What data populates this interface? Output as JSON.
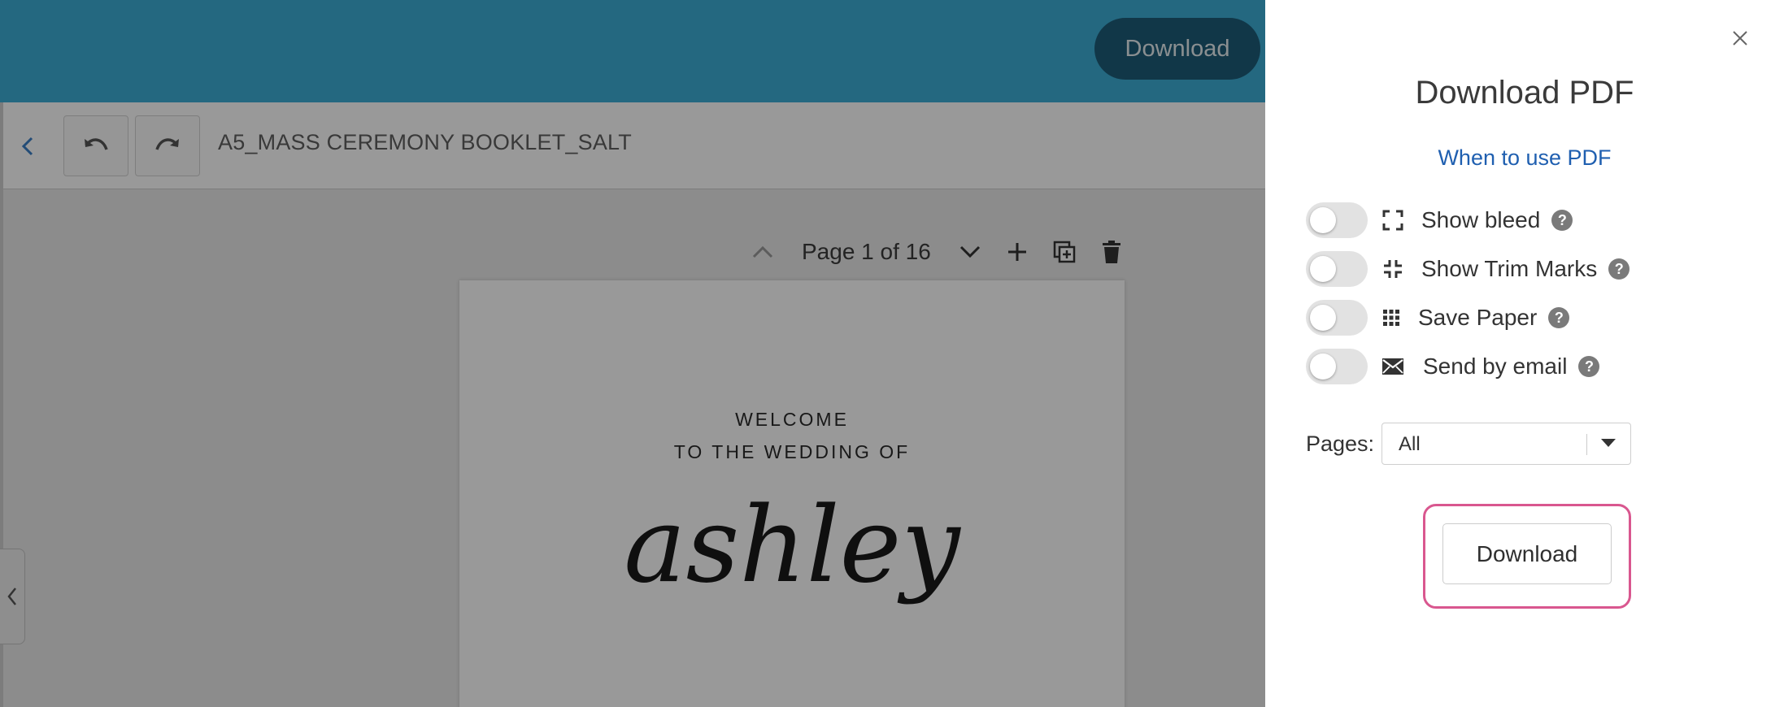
{
  "header": {
    "download_label": "Download"
  },
  "toolbar": {
    "document_title": "A5_MASS CEREMONY BOOKLET_SALT"
  },
  "page_nav": {
    "label": "Page 1 of 16"
  },
  "page_content": {
    "welcome_line1": "WELCOME",
    "welcome_line2": "TO THE WEDDING OF",
    "script_name": "ashley"
  },
  "modal": {
    "title": "Download PDF",
    "help_link": "When to use PDF",
    "options": [
      {
        "label": "Show bleed",
        "icon": "expand-corners-icon",
        "enabled": false
      },
      {
        "label": "Show Trim Marks",
        "icon": "trim-marks-icon",
        "enabled": false
      },
      {
        "label": "Save Paper",
        "icon": "grid-icon",
        "enabled": false
      },
      {
        "label": "Send by email",
        "icon": "envelope-icon",
        "enabled": false
      }
    ],
    "help_glyph": "?",
    "pages_label": "Pages:",
    "pages_value": "All",
    "download_label": "Download"
  },
  "colors": {
    "header_bg": "#3dadd5",
    "header_button": "#1d5d78",
    "link": "#1f5fb0",
    "highlight": "#d9578f"
  }
}
